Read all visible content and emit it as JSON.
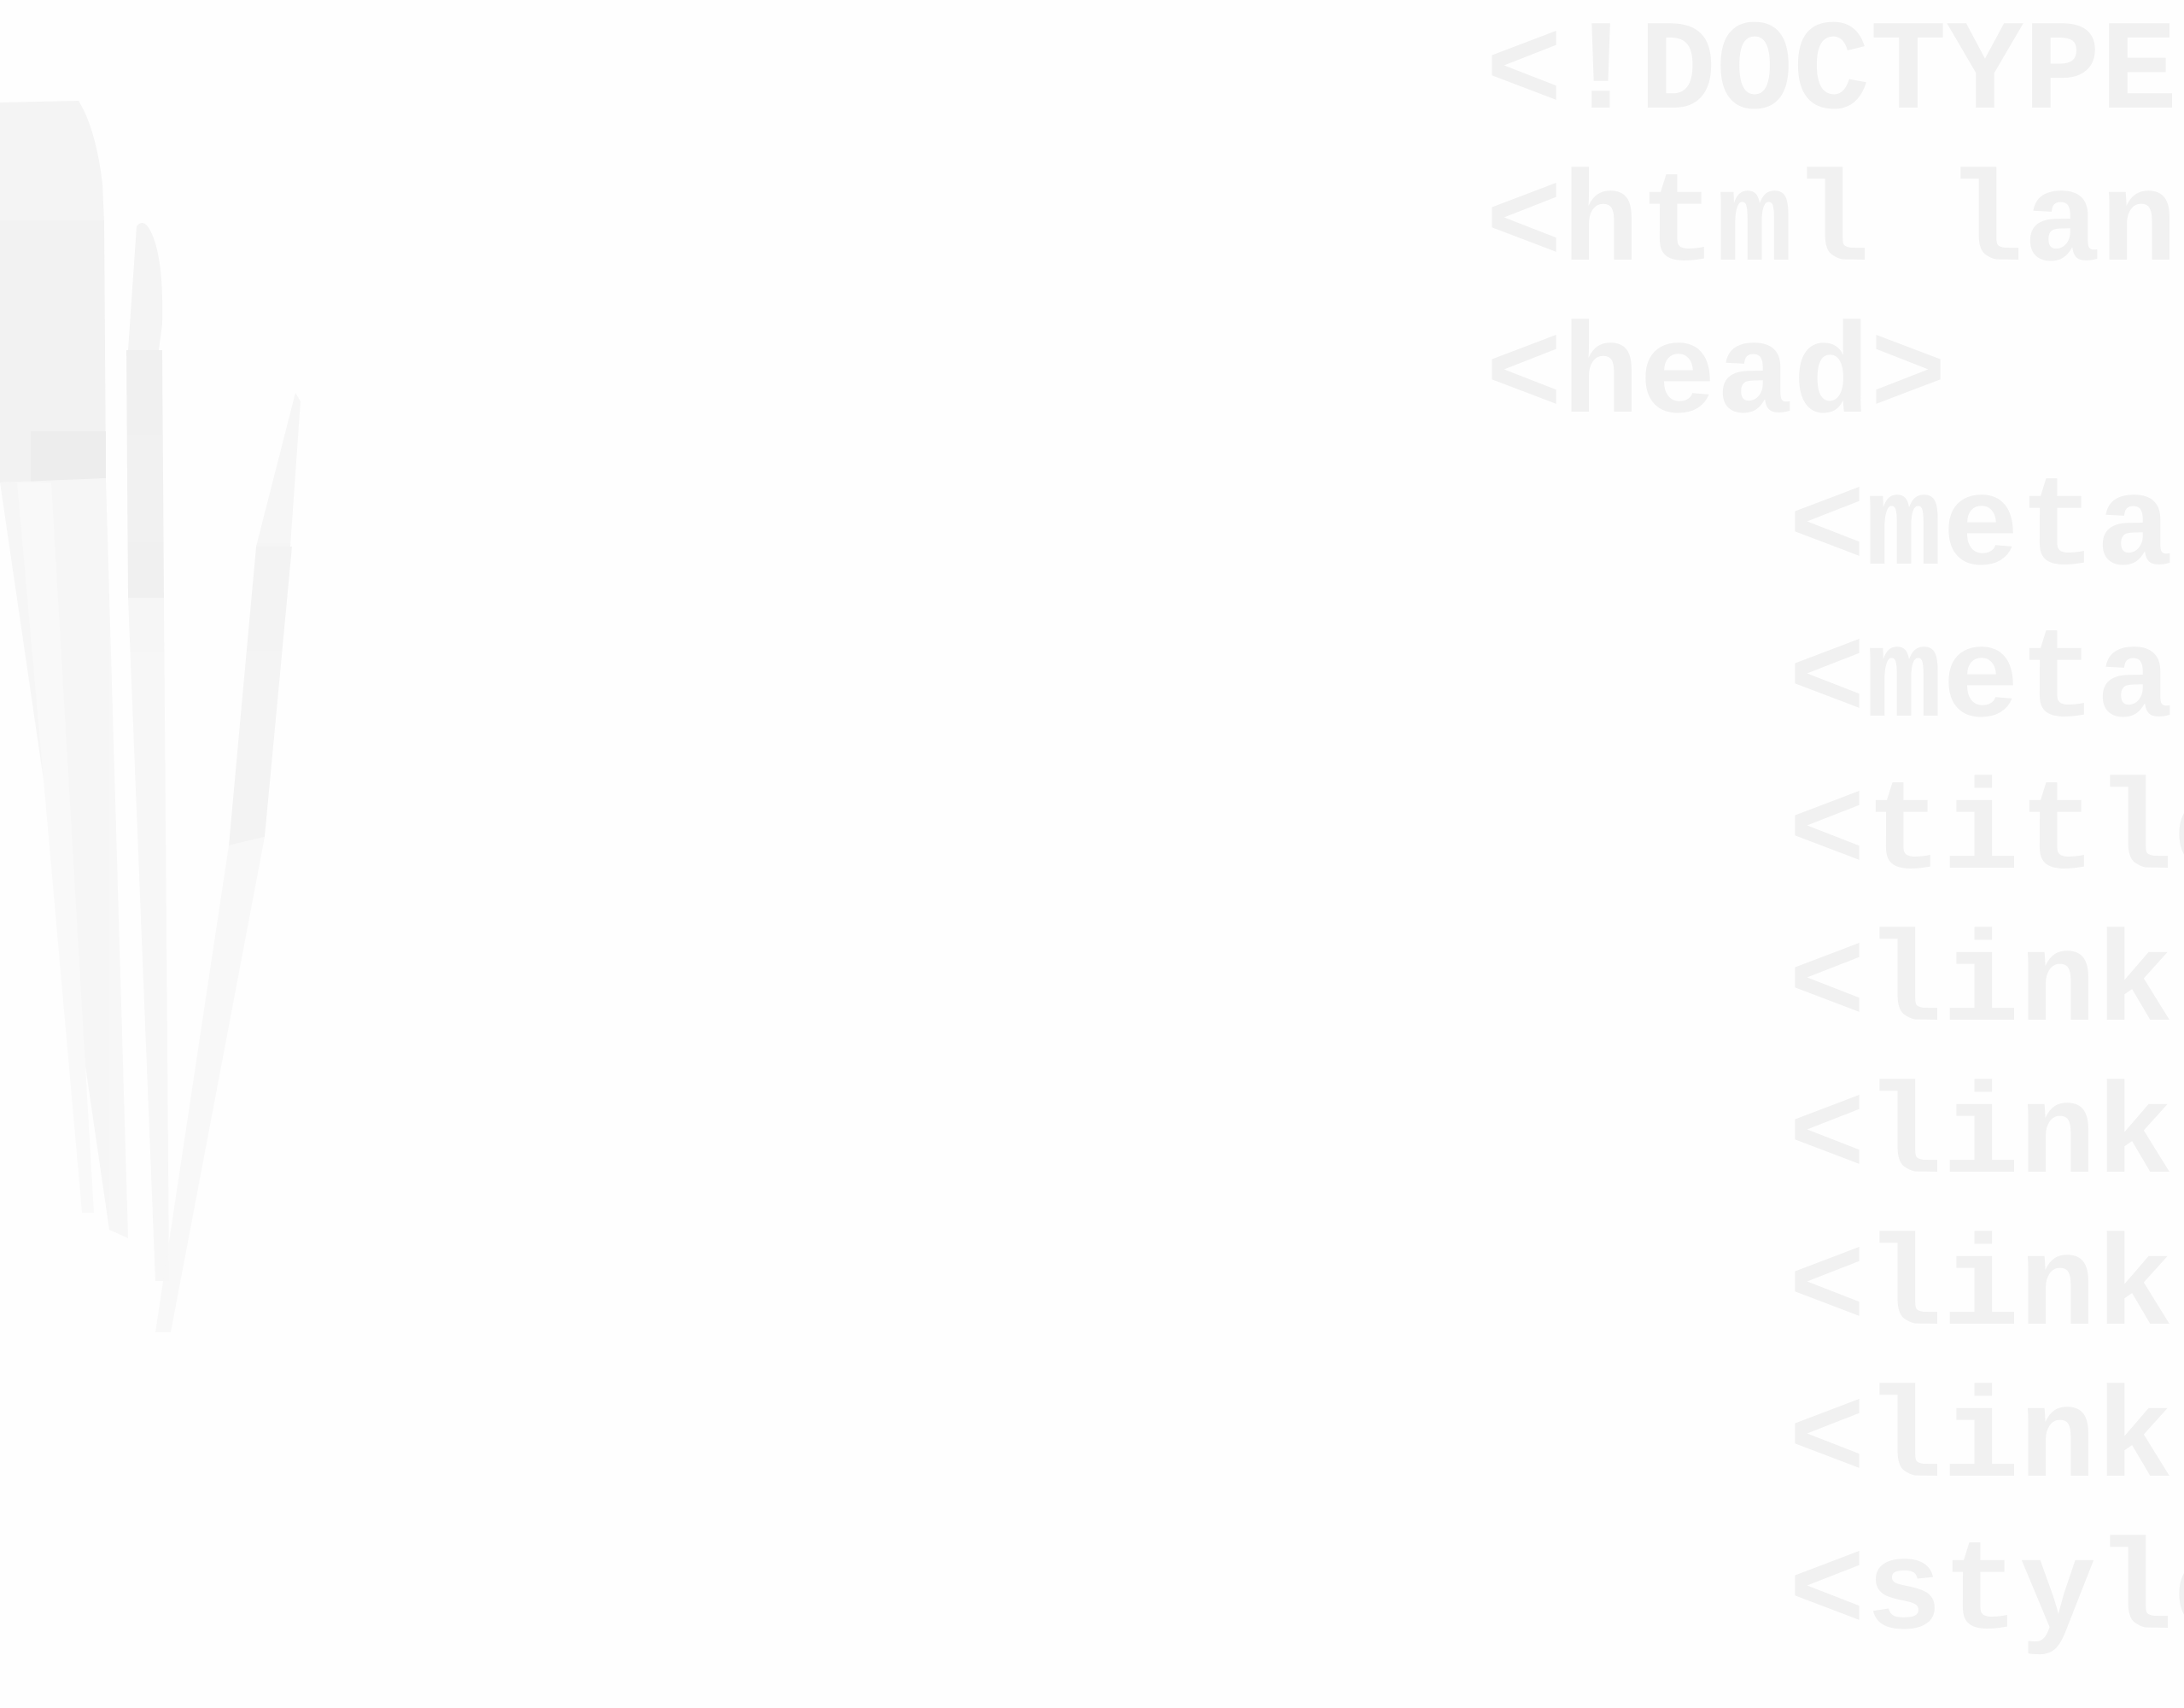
{
  "background": {
    "color": "#fefefe",
    "decoration": "paint-brushes-illustration"
  },
  "code_watermark": {
    "color": "#f1f1f1",
    "lines": [
      "<!DOCTYPE",
      "<html lang",
      "<head>",
      "<meta",
      "<meta",
      "<title",
      "<link",
      "<link",
      "<link",
      "<link",
      "<style"
    ]
  }
}
